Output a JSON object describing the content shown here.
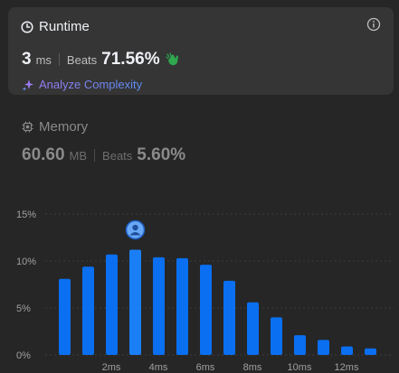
{
  "runtime": {
    "title": "Runtime",
    "value": "3",
    "unit": "ms",
    "beats_label": "Beats",
    "beats_value": "71.56%",
    "analyze_label": "Analyze Complexity",
    "icons": [
      "clock-icon",
      "info-icon",
      "clap-icon",
      "sparkle-icon"
    ]
  },
  "memory": {
    "title": "Memory",
    "value": "60.60",
    "unit": "MB",
    "beats_label": "Beats",
    "beats_value": "5.60%",
    "icons": [
      "chip-icon"
    ]
  },
  "chart_data": {
    "type": "bar",
    "y_ticks": [
      "15%",
      "10%",
      "5%",
      "0%"
    ],
    "x_ticks": [
      "2ms",
      "4ms",
      "6ms",
      "8ms",
      "10ms",
      "12ms"
    ],
    "ylim": [
      0,
      15
    ],
    "values": [
      8.1,
      9.4,
      10.7,
      11.2,
      10.4,
      10.3,
      9.6,
      7.9,
      5.6,
      4.0,
      2.1,
      1.6,
      0.9,
      0.7
    ],
    "highlight_index": 3,
    "marker": "user-avatar",
    "colors": {
      "bar": "#0a6ff0",
      "highlight": "#1a7ff5",
      "grid": "#3c3c3c",
      "tick": "#a0a0a0"
    }
  }
}
